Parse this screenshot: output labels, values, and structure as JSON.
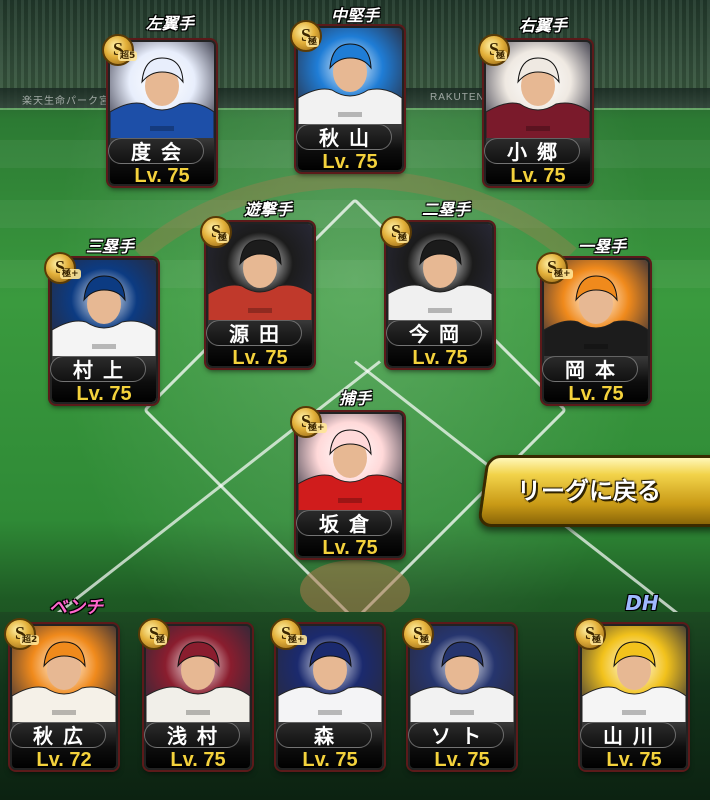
{
  "stadium": {
    "wall_left": "楽天生命パーク宮城",
    "wall_center": "RAKUTEN"
  },
  "buttons": {
    "back_to_league": "リーグに戻る"
  },
  "players": [
    {
      "key": "lf",
      "position": "左翼手",
      "name": "度会",
      "level": "Lv. 75",
      "rank": "S",
      "rank_sub": "超5",
      "jersey": "#1d4fa8",
      "accent": "#e8eefc"
    },
    {
      "key": "cf",
      "position": "中堅手",
      "name": "秋山",
      "level": "Lv. 75",
      "rank": "S",
      "rank_sub": "極",
      "jersey": "#f2f2f2",
      "accent": "#1f7dd6"
    },
    {
      "key": "rf",
      "position": "右翼手",
      "name": "小郷",
      "level": "Lv. 75",
      "rank": "S",
      "rank_sub": "極",
      "jersey": "#7a1a2b",
      "accent": "#efe9e2"
    },
    {
      "key": "ss",
      "position": "遊撃手",
      "name": "源田",
      "level": "Lv. 75",
      "rank": "S",
      "rank_sub": "極",
      "jersey": "#c0392b",
      "accent": "#1c1c1c"
    },
    {
      "key": "2b",
      "position": "二塁手",
      "name": "今岡",
      "level": "Lv. 75",
      "rank": "S",
      "rank_sub": "極",
      "jersey": "#f0f0f0",
      "accent": "#1b1b1b"
    },
    {
      "key": "3b",
      "position": "三塁手",
      "name": "村上",
      "level": "Lv. 75",
      "rank": "S",
      "rank_sub": "極+",
      "jersey": "#f4f4f4",
      "accent": "#0c3b82"
    },
    {
      "key": "1b",
      "position": "一塁手",
      "name": "岡本",
      "level": "Lv. 75",
      "rank": "S",
      "rank_sub": "極+",
      "jersey": "#1c1c1c",
      "accent": "#f08a1c"
    },
    {
      "key": "c",
      "position": "捕手",
      "name": "坂倉",
      "level": "Lv. 75",
      "rank": "S",
      "rank_sub": "極+",
      "jersey": "#d01c1c",
      "accent": "#ffd9d9"
    }
  ],
  "bench_label": "ベンチ",
  "dh_label": "DH",
  "bench": [
    {
      "key": "b1",
      "name": "秋広",
      "level": "Lv. 72",
      "rank": "S",
      "rank_sub": "超2",
      "jersey": "#f5f1e8",
      "accent": "#f08a1c"
    },
    {
      "key": "b2",
      "name": "浅村",
      "level": "Lv. 75",
      "rank": "S",
      "rank_sub": "極",
      "jersey": "#f1efe9",
      "accent": "#8a1d2e"
    },
    {
      "key": "b3",
      "name": "森",
      "level": "Lv. 75",
      "rank": "S",
      "rank_sub": "極+",
      "jersey": "#f4f4f6",
      "accent": "#1b2a6e"
    },
    {
      "key": "b4",
      "name": "ソト",
      "level": "Lv. 75",
      "rank": "S",
      "rank_sub": "極",
      "jersey": "#f2f2f2",
      "accent": "#26356e"
    },
    {
      "key": "dh",
      "name": "山川",
      "level": "Lv. 75",
      "rank": "S",
      "rank_sub": "極",
      "jersey": "#f5f5f5",
      "accent": "#f2c21c"
    }
  ]
}
